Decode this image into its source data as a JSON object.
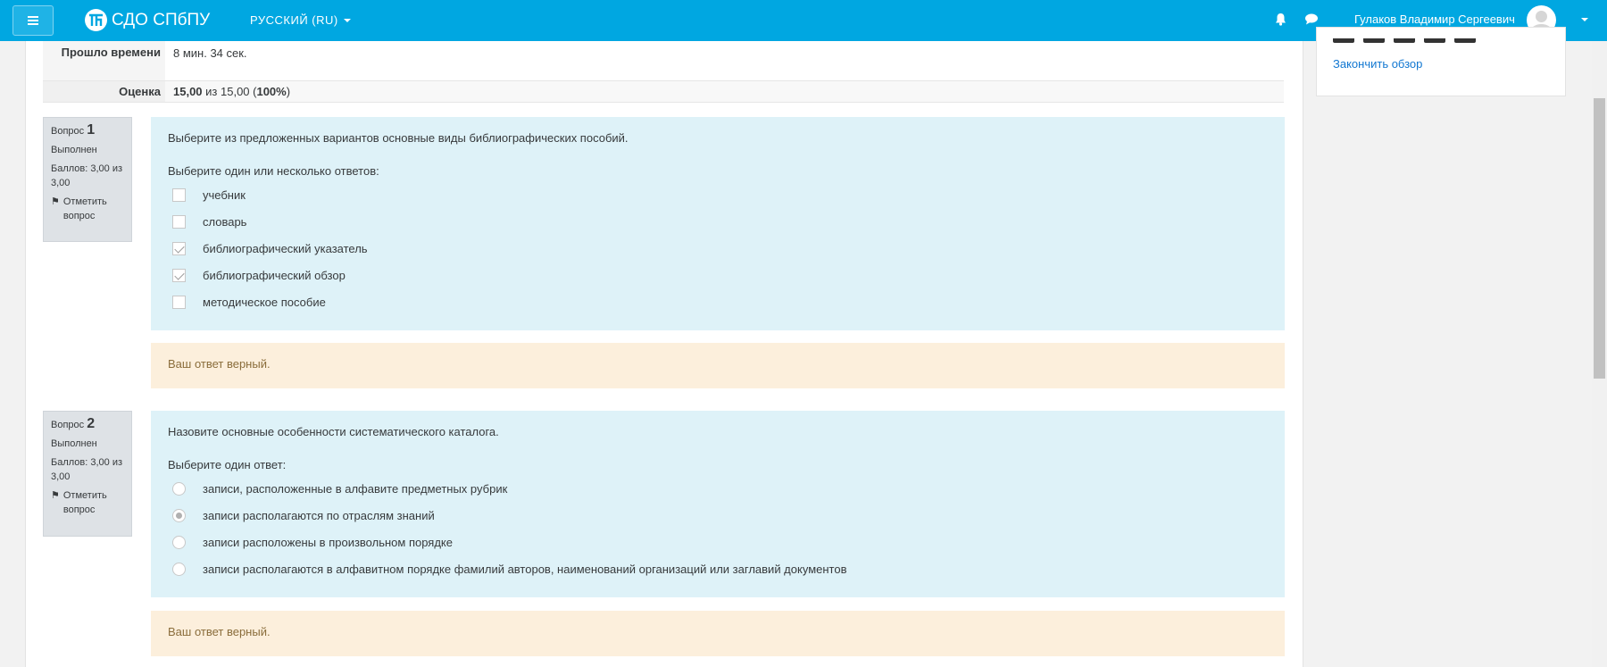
{
  "header": {
    "brand": "СДО СПбПУ",
    "language": "РУССКИЙ (RU)",
    "user_name": "Гулаков Владимир Сергеевич",
    "colors": {
      "navbar": "#00a7e1"
    }
  },
  "summary": {
    "elapsed_label": "Прошло времени",
    "elapsed_value": "8 мин. 34 сек.",
    "grade_label": "Оценка",
    "grade_score": "15,00",
    "grade_rest": " из 15,00 (",
    "grade_percent": "100%",
    "grade_close": ")"
  },
  "questions": [
    {
      "label": "Вопрос",
      "number": "1",
      "state": "Выполнен",
      "marks": "Баллов: 3,00 из 3,00",
      "flag": "Отметить вопрос",
      "text": "Выберите из предложенных вариантов основные виды библиографических пособий.",
      "prompt": "Выберите один или несколько ответов:",
      "answers": [
        {
          "text": "учебник",
          "checked": false
        },
        {
          "text": "словарь",
          "checked": false
        },
        {
          "text": "библиографический указатель",
          "checked": true
        },
        {
          "text": "библиографический обзор",
          "checked": true
        },
        {
          "text": "методическое пособие",
          "checked": false
        }
      ],
      "feedback": "Ваш ответ верный."
    },
    {
      "label": "Вопрос",
      "number": "2",
      "state": "Выполнен",
      "marks": "Баллов: 3,00 из 3,00",
      "flag": "Отметить вопрос",
      "text": "Назовите основные особенности систематического каталога.",
      "prompt": "Выберите один ответ:",
      "answers": [
        {
          "text": "записи, расположенные в алфавите предметных рубрик",
          "checked": false
        },
        {
          "text": "записи располагаются по отраслям знаний",
          "checked": true
        },
        {
          "text": "записи расположены в произвольном порядке",
          "checked": false
        },
        {
          "text": "записи располагаются в алфавитном порядке фамилий авторов, наименований организаций или заглавий документов",
          "checked": false
        }
      ],
      "feedback": "Ваш ответ верный."
    }
  ],
  "sidebar": {
    "finish_review": "Закончить обзор"
  }
}
